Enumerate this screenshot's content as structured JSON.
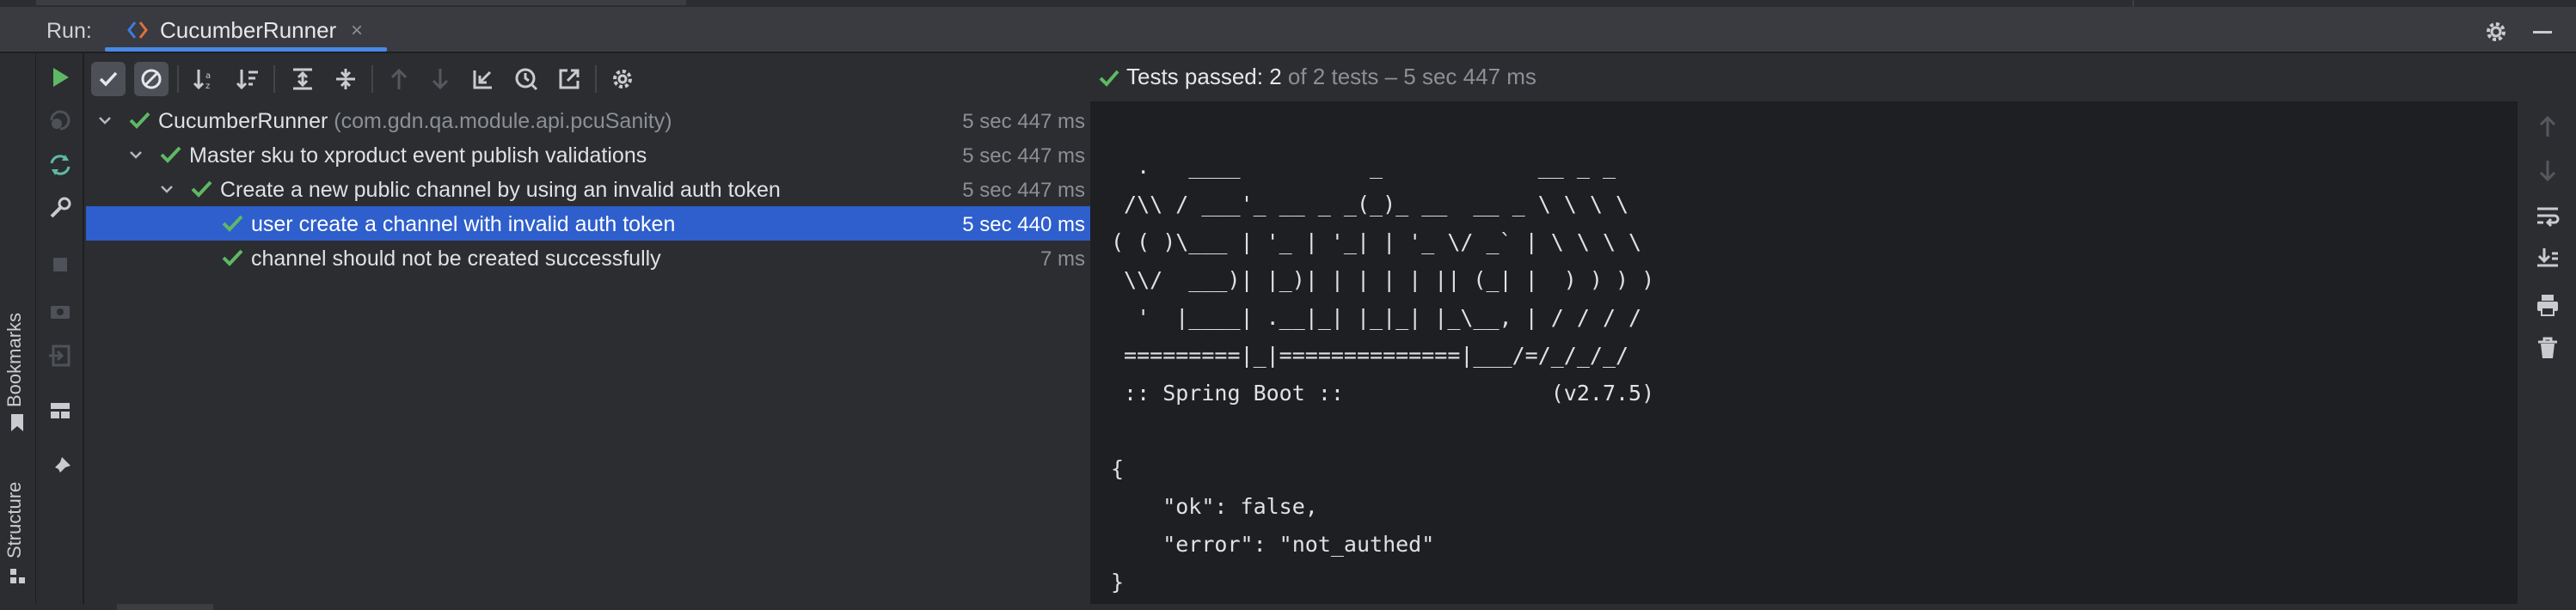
{
  "header": {
    "run_label": "Run:",
    "tab_label": "CucumberRunner",
    "tab_close": "×"
  },
  "toolstrip": {
    "bookmarks_label": "Bookmarks",
    "structure_label": "Structure"
  },
  "summary": {
    "status_text": "Tests passed: 2",
    "detail_text": " of 2 tests – 5 sec 447 ms"
  },
  "tree": {
    "rows": [
      {
        "label": "CucumberRunner",
        "package": " (com.gdn.qa.module.api.pcuSanity)",
        "duration": "5 sec 447 ms"
      },
      {
        "label": "Master sku to xproduct event publish validations",
        "duration": "5 sec 447 ms"
      },
      {
        "label": "Create a new public channel by using an invalid auth token",
        "duration": "5 sec 447 ms"
      },
      {
        "label": "user create a channel with invalid auth token",
        "duration": "5 sec 440 ms"
      },
      {
        "label": "channel should not be created successfully",
        "duration": "7 ms"
      }
    ]
  },
  "console": {
    "output": "  .   ____          _            __ _ _\n /\\\\ / ___'_ __ _ _(_)_ __  __ _ \\ \\ \\ \\\n( ( )\\___ | '_ | '_| | '_ \\/ _` | \\ \\ \\ \\\n \\\\/  ___)| |_)| | | | | || (_| |  ) ) ) )\n  '  |____| .__|_| |_|_| |_\\__, | / / / /\n =========|_|==============|___/=/_/_/_/\n :: Spring Boot ::                (v2.7.5)\n\n{\n    \"ok\": false,\n    \"error\": \"not_authed\"\n}"
  },
  "colors": {
    "accent": "#4a88e8",
    "success": "#5fb865",
    "selection": "#2e5fcc",
    "run_green": "#5fb865"
  },
  "icons": {
    "tab": "cucumber-icon",
    "settings": "gear-icon",
    "hide": "minimize-icon"
  }
}
